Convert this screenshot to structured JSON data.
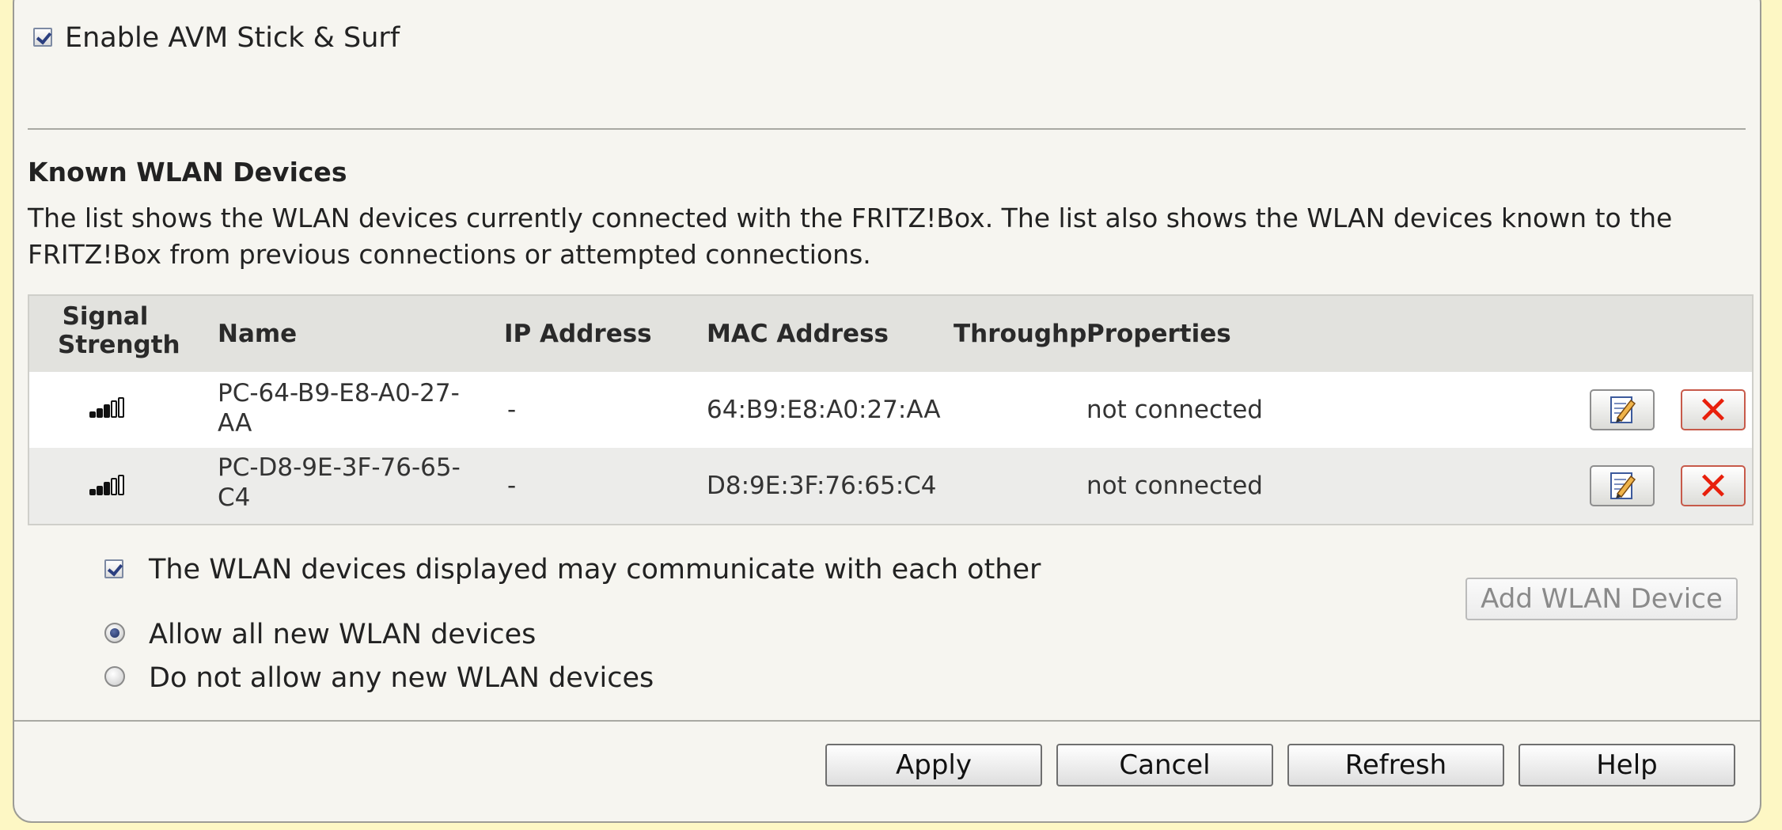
{
  "stick_surf": {
    "label": "Enable AVM Stick & Surf",
    "checked": true
  },
  "known_devices": {
    "heading": "Known WLAN Devices",
    "description_line1": "The list shows the WLAN devices currently connected with the FRITZ!Box. The list also shows the WLAN devices known to the",
    "description_line2": "FRITZ!Box from previous connections or attempted connections."
  },
  "table": {
    "headers": {
      "signal_line1": "Signal",
      "signal_line2": "Strength",
      "name": "Name",
      "ip": "IP Address",
      "mac": "MAC Address",
      "throughput": "Throughput",
      "properties": "Properties"
    },
    "rows": [
      {
        "name_line1": "PC-64-B9-E8-A0-27-",
        "name_line2": "AA",
        "ip": "-",
        "mac": "64:B9:E8:A0:27:AA",
        "throughput": "",
        "properties": "not connected",
        "signal_icon": "signal-strength-icon"
      },
      {
        "name_line1": "PC-D8-9E-3F-76-65-",
        "name_line2": "C4",
        "ip": "-",
        "mac": "D8:9E:3F:76:65:C4",
        "throughput": "",
        "properties": "not connected",
        "signal_icon": "signal-strength-icon"
      }
    ]
  },
  "communicate": {
    "label": "The WLAN devices displayed may communicate with each other",
    "checked": true
  },
  "add_device_label": "Add WLAN Device",
  "radio_allow": {
    "label": "Allow all new WLAN devices",
    "selected": true
  },
  "radio_deny": {
    "label": "Do not allow any new WLAN devices",
    "selected": false
  },
  "footer": {
    "apply": "Apply",
    "cancel": "Cancel",
    "refresh": "Refresh",
    "help": "Help"
  },
  "colors": {
    "page_background": "#fdf7c4",
    "panel_background": "#f6f5f0",
    "delete_icon": "#e8200c"
  }
}
